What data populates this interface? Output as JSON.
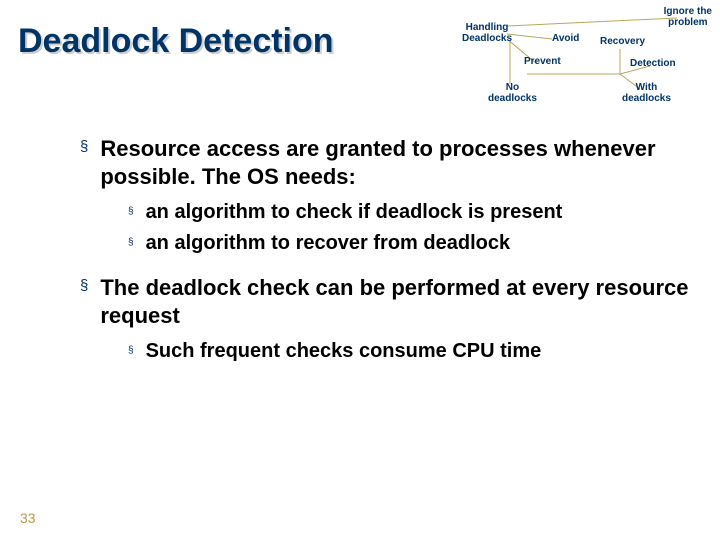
{
  "title": "Deadlock Detection",
  "diagram": {
    "root": "Handling\nDeadlocks",
    "ignore": "Ignore the\nproblem",
    "avoid": "Avoid",
    "prevent": "Prevent",
    "recovery": "Recovery",
    "detection": "Detection",
    "no_deadlocks": "No\ndeadlocks",
    "with_deadlocks": "With\ndeadlocks"
  },
  "bullets": [
    {
      "text": "Resource access are granted to processes whenever possible. The OS needs:",
      "sub": [
        "an algorithm to check if deadlock is present",
        "an algorithm to recover from deadlock"
      ]
    },
    {
      "text": "The deadlock check can be performed at every resource request",
      "sub": [
        "Such frequent checks consume CPU time"
      ]
    }
  ],
  "slide_number": "33"
}
